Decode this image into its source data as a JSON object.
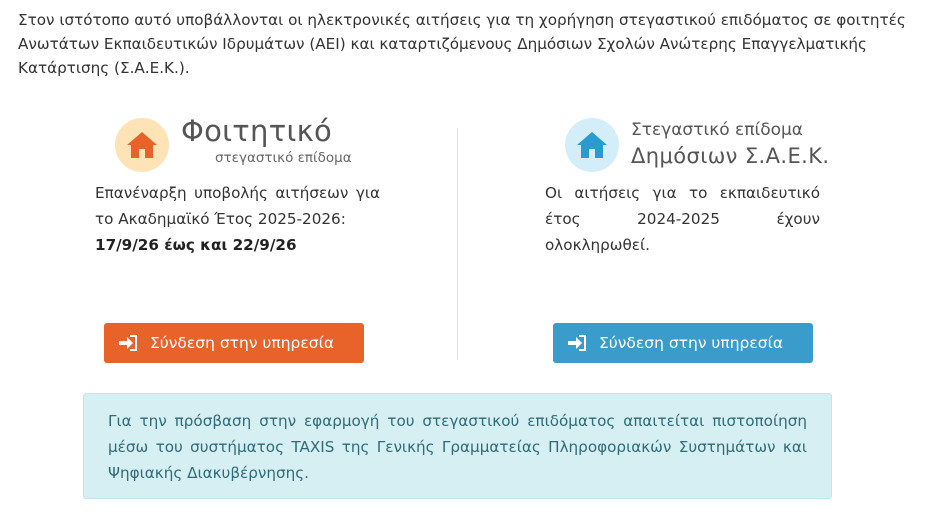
{
  "intro": {
    "text": "Στον ιστότοπο αυτό υποβάλλονται οι ηλεκτρονικές αιτήσεις για τη χορήγηση στεγαστικού επιδόματος σε φοιτητές Ανωτάτων Εκπαιδευτικών Ιδρυμάτων (ΑΕΙ) και καταρτιζόμενους Δημόσιων Σχολών Ανώτερης Επαγγελματικής Κατάρτισης (Σ.Α.Ε.Κ.)."
  },
  "student": {
    "logo_title": "Φοιτητικό",
    "logo_subtitle": "στεγαστικό επίδομα",
    "description": "Επανέναρξη υποβολής αιτήσεων για το Ακαδημαϊκό Έτος 2025-2026:",
    "dates": "17/9/26 έως και 22/9/26",
    "button_label": "Σύνδεση στην υπηρεσία"
  },
  "saek": {
    "logo_title": "Στεγαστικό επίδομα",
    "logo_subtitle": "Δημόσιων Σ.Α.Ε.Κ.",
    "description": "Οι αιτήσεις για το εκπαιδευτικό έτος 2024-2025 έχουν ολοκληρωθεί.",
    "button_label": "Σύνδεση στην υπηρεσία"
  },
  "info": {
    "text": "Για την πρόσβαση στην εφαρμογή του στεγαστικού επιδόματος απαιτείται πιστοποίηση μέσω του συστήματος TAXIS της Γενικής Γραμματείας Πληροφοριακών Συστημάτων και Ψηφιακής Διακυβέρνησης."
  },
  "icons": {
    "student_logo": "house-icon",
    "saek_logo": "house-icon",
    "button": "sign-in-icon"
  },
  "colors": {
    "orange_button": "#e8632a",
    "blue_button": "#3a9ccb",
    "info_background": "#d6eff2",
    "info_text": "#2f6b78"
  }
}
